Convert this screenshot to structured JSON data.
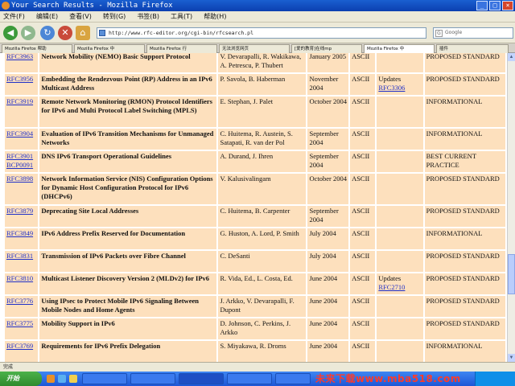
{
  "window": {
    "title": "Your Search Results - Mozilla Firefox",
    "buttons": [
      "_",
      "□",
      "×"
    ]
  },
  "menu": [
    "文件(F)",
    "编辑(E)",
    "查看(V)",
    "转到(G)",
    "书签(B)",
    "工具(T)",
    "帮助(H)"
  ],
  "nav": {
    "url": "http://www.rfc-editor.org/cgi-bin/rfcsearch.pl",
    "search_placeholder": "Google"
  },
  "tabs": [
    "Mozilla Firefox 帮助",
    "Mozilla Firefox 中",
    "Mozilla Firefox 行",
    "无法浏览网页",
    "[爱的教育]在线mp",
    "Mozilla Firefox 中",
    "插件"
  ],
  "rows": [
    {
      "num": "RFC3963",
      "title": "Network Mobility (NEMO) Basic Support Protocol",
      "authors": "V. Devarapalli, R. Wakikawa, A. Petrescu, P. Thubert",
      "date": "January 2005",
      "format": "ASCII",
      "obs": "",
      "obs_link": "",
      "status": "PROPOSED STANDARD"
    },
    {
      "num": "RFC3956",
      "title": "Embedding the Rendezvous Point (RP) Address in an IPv6 Multicast Address",
      "authors": "P. Savola, B. Haberman",
      "date": "November 2004",
      "format": "ASCII",
      "obs": "Updates",
      "obs_link": "RFC3306",
      "status": "PROPOSED STANDARD"
    },
    {
      "num": "RFC3919",
      "title": "Remote Network Monitoring (RMON) Protocol Identifiers for IPv6 and Multi Protocol Label Switching (MPLS)",
      "authors": "E. Stephan, J. Palet",
      "date": "October 2004",
      "format": "ASCII",
      "obs": "",
      "obs_link": "",
      "status": "INFORMATIONAL"
    },
    {
      "num": "RFC3904",
      "title": "Evaluation of IPv6 Transition Mechanisms for Unmanaged Networks",
      "authors": "C. Huitema, R. Austein, S. Satapati, R. van der Pol",
      "date": "September 2004",
      "format": "ASCII",
      "obs": "",
      "obs_link": "",
      "status": "INFORMATIONAL"
    },
    {
      "num": "RFC3901",
      "num2": "BCP0091",
      "title": "DNS IPv6 Transport Operational Guidelines",
      "authors": "A. Durand, J. Ihren",
      "date": "September 2004",
      "format": "ASCII",
      "obs": "",
      "obs_link": "",
      "status": "BEST CURRENT PRACTICE"
    },
    {
      "num": "RFC3898",
      "title": "Network Information Service (NIS) Configuration Options for Dynamic Host Configuration Protocol for IPv6 (DHCPv6)",
      "authors": "V. Kalusivalingam",
      "date": "October 2004",
      "format": "ASCII",
      "obs": "",
      "obs_link": "",
      "status": "PROPOSED STANDARD"
    },
    {
      "num": "RFC3879",
      "title": "Deprecating Site Local Addresses",
      "authors": "C. Huitema, B. Carpenter",
      "date": "September 2004",
      "format": "ASCII",
      "obs": "",
      "obs_link": "",
      "status": "PROPOSED STANDARD"
    },
    {
      "num": "RFC3849",
      "title": "IPv6 Address Prefix Reserved for Documentation",
      "authors": "G. Huston, A. Lord, P. Smith",
      "date": "July 2004",
      "format": "ASCII",
      "obs": "",
      "obs_link": "",
      "status": "INFORMATIONAL"
    },
    {
      "num": "RFC3831",
      "title": "Transmission of IPv6 Packets over Fibre Channel",
      "authors": "C. DeSanti",
      "date": "July 2004",
      "format": "ASCII",
      "obs": "",
      "obs_link": "",
      "status": "PROPOSED STANDARD"
    },
    {
      "num": "RFC3810",
      "title": "Multicast Listener Discovery Version 2 (MLDv2) for IPv6",
      "authors": "R. Vida, Ed., L. Costa, Ed.",
      "date": "June 2004",
      "format": "ASCII",
      "obs": "Updates",
      "obs_link": "RFC2710",
      "status": "PROPOSED STANDARD"
    },
    {
      "num": "RFC3776",
      "title": "Using IPsec to Protect Mobile IPv6 Signaling Between Mobile Nodes and Home Agents",
      "authors": "J. Arkko, V. Devarapalli, F. Dupont",
      "date": "June 2004",
      "format": "ASCII",
      "obs": "",
      "obs_link": "",
      "status": "PROPOSED STANDARD"
    },
    {
      "num": "RFC3775",
      "title": "Mobility Support in IPv6",
      "authors": "D. Johnson, C. Perkins, J. Arkko",
      "date": "June 2004",
      "format": "ASCII",
      "obs": "",
      "obs_link": "",
      "status": "PROPOSED STANDARD"
    },
    {
      "num": "RFC3769",
      "title": "Requirements for IPv6 Prefix Delegation",
      "authors": "S. Miyakawa, R. Droms",
      "date": "June 2004",
      "format": "ASCII",
      "obs": "",
      "obs_link": "",
      "status": "INFORMATIONAL"
    }
  ],
  "status_text": "完成",
  "taskbar": {
    "start_label": "开始",
    "watermark": "未来下载www.mba518.com"
  },
  "colors": {
    "cell_bg": "#fde0bd",
    "link": "#2030c8",
    "titlebar": "#0b3fb0"
  }
}
